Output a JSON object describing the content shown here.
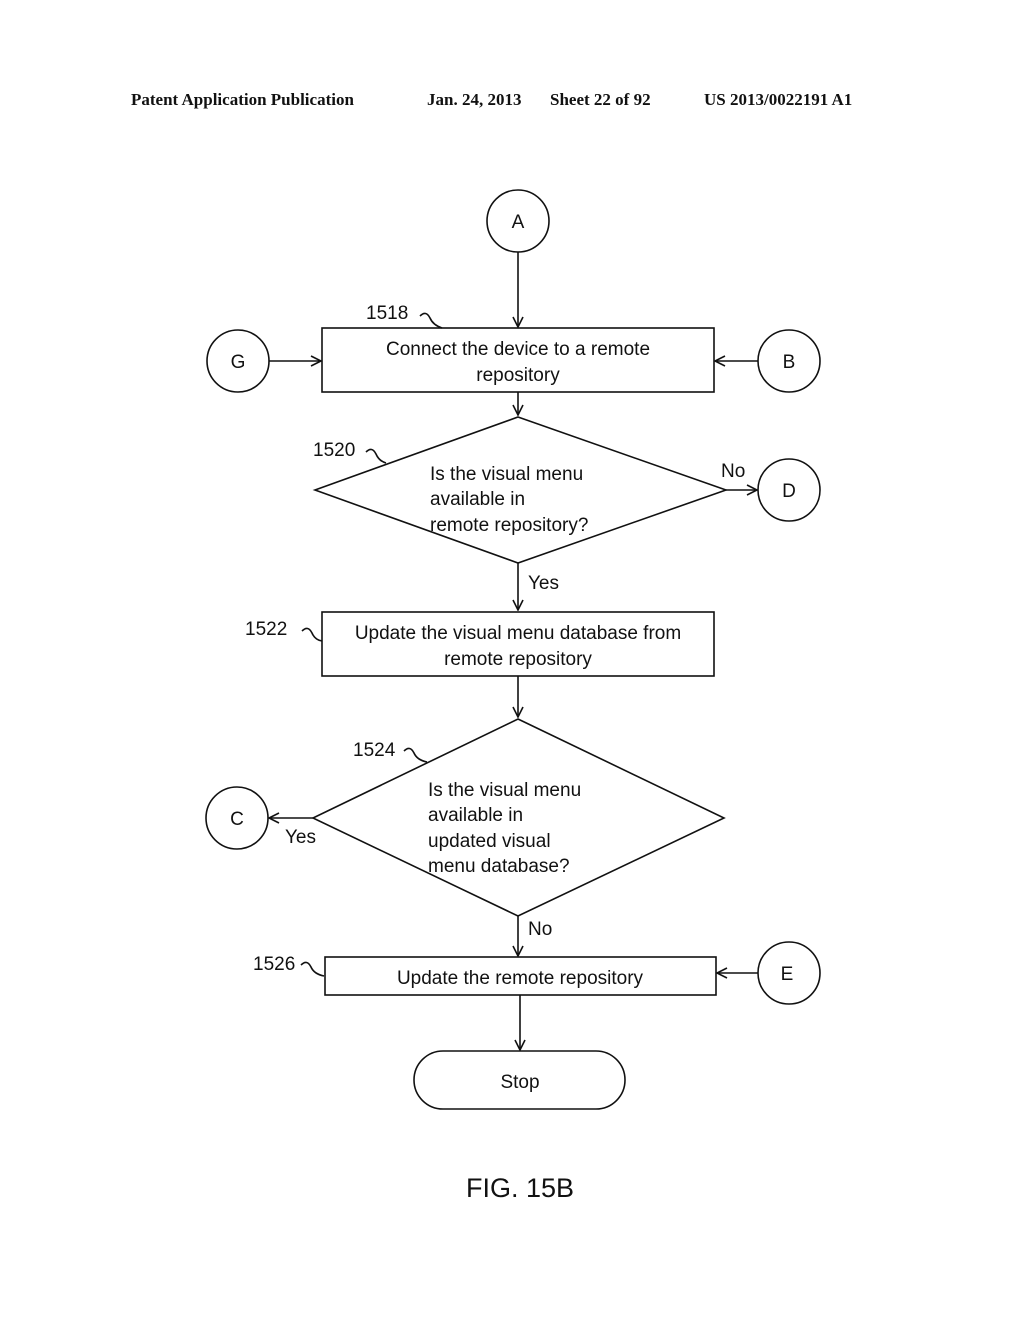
{
  "header": {
    "left": "Patent Application Publication",
    "date": "Jan. 24, 2013",
    "sheet": "Sheet 22 of 92",
    "number": "US 2013/0022191 A1"
  },
  "connectors": {
    "A": "A",
    "B": "B",
    "C": "C",
    "D": "D",
    "E": "E",
    "G": "G"
  },
  "steps": {
    "s1518": {
      "ref": "1518",
      "lines": [
        "Connect the device to a remote",
        "repository"
      ]
    },
    "s1520": {
      "ref": "1520",
      "lines": [
        "Is the visual menu",
        "available in",
        "remote repository?"
      ],
      "no": "No",
      "yes": "Yes"
    },
    "s1522": {
      "ref": "1522",
      "lines": [
        "Update the visual menu database from",
        "remote repository"
      ]
    },
    "s1524": {
      "ref": "1524",
      "lines": [
        "Is the visual menu",
        "available in",
        "updated visual",
        "menu database?"
      ],
      "yes": "Yes",
      "no": "No"
    },
    "s1526": {
      "ref": "1526",
      "lines": [
        "Update the remote repository"
      ]
    },
    "stop": {
      "label": "Stop"
    }
  },
  "caption": "FIG. 15B"
}
